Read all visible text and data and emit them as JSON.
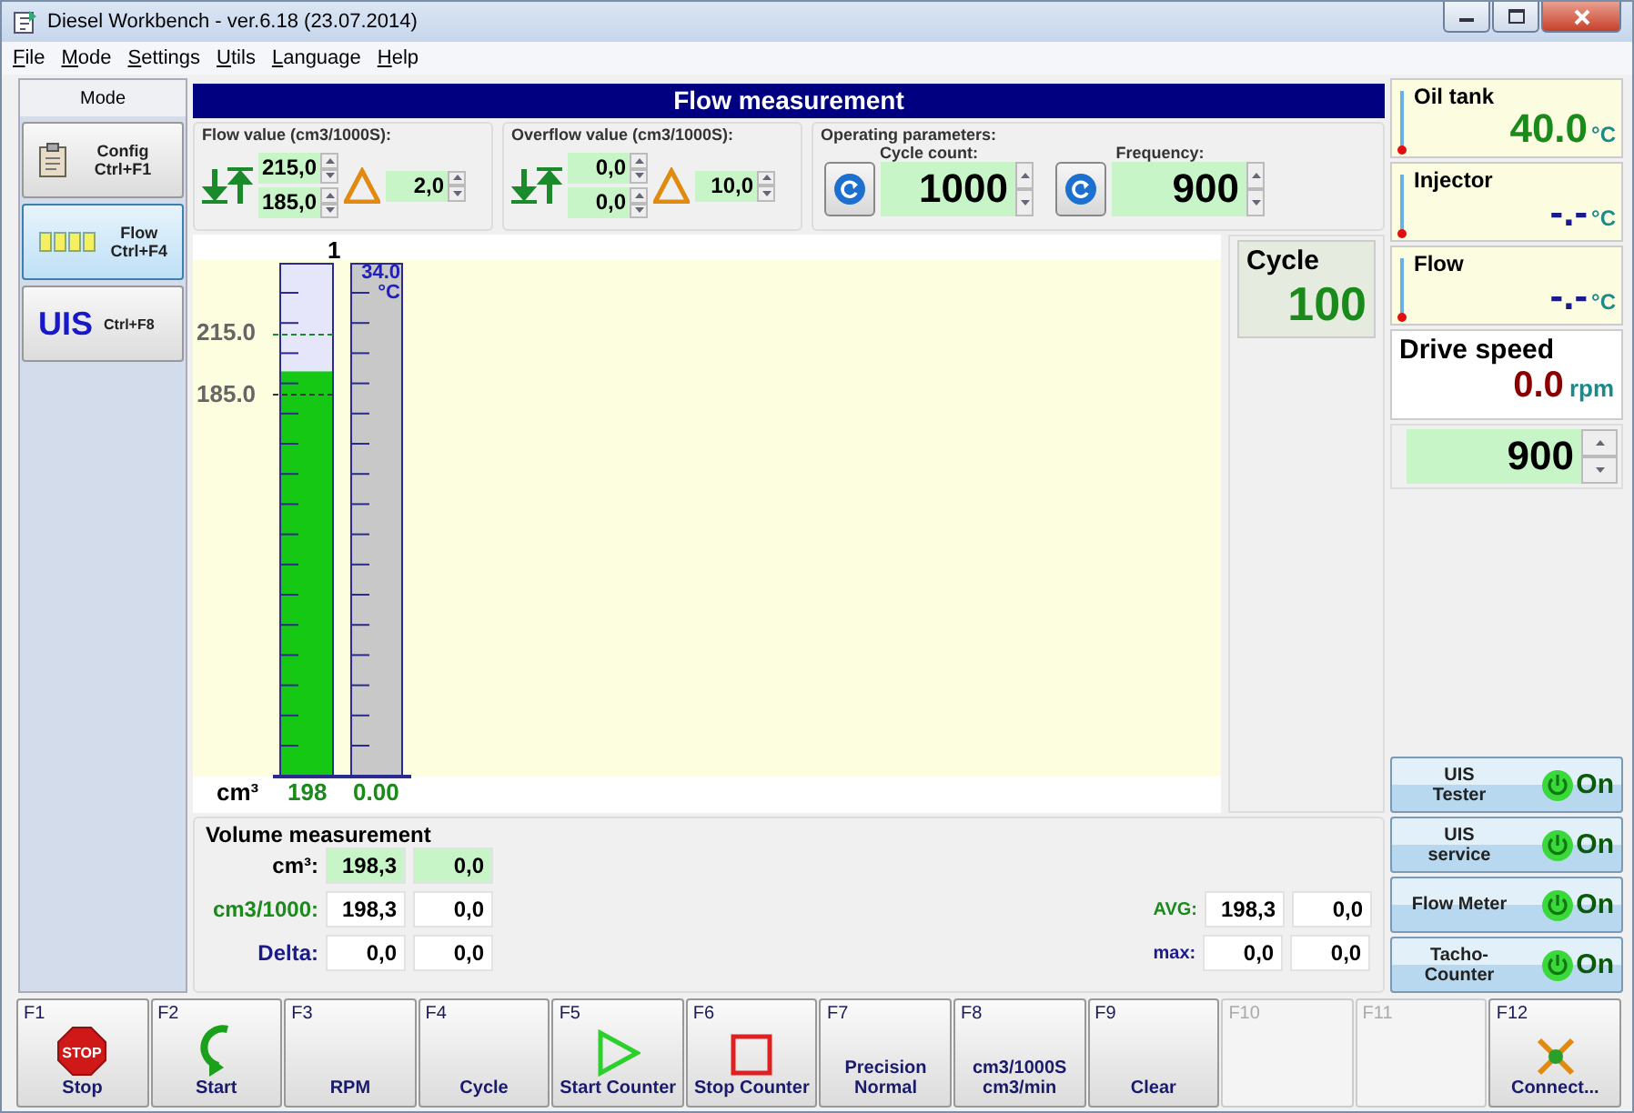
{
  "window": {
    "title": "Diesel Workbench - ver.6.18 (23.07.2014)"
  },
  "menu": [
    {
      "label": "File"
    },
    {
      "label": "Mode"
    },
    {
      "label": "Settings"
    },
    {
      "label": "Utils"
    },
    {
      "label": "Language"
    },
    {
      "label": "Help"
    }
  ],
  "mode_panel": {
    "title": "Mode",
    "items": [
      {
        "label": "Config",
        "shortcut": "Ctrl+F1",
        "kind": "clipboard",
        "selected": false
      },
      {
        "label": "Flow",
        "shortcut": "Ctrl+F4",
        "kind": "bars",
        "selected": true
      },
      {
        "label": "UIS",
        "shortcut": "Ctrl+F8",
        "kind": "big",
        "selected": false
      }
    ]
  },
  "header": {
    "title": "Flow measurement"
  },
  "flow_value": {
    "label": "Flow value (cm3/1000S):",
    "upper": "215,0",
    "lower": "185,0",
    "delta": "2,0"
  },
  "overflow_value": {
    "label": "Overflow value (cm3/1000S):",
    "upper": "0,0",
    "lower": "0,0",
    "delta": "10,0"
  },
  "operating_parameters": {
    "label": "Operating parameters:",
    "fields": [
      {
        "label": "Cycle count:",
        "value": "1000"
      },
      {
        "label": "Frequency:",
        "value": "900"
      }
    ]
  },
  "gauge": {
    "column": "1",
    "upper_mark": "215.0",
    "lower_mark": "185.0",
    "level": 0.79,
    "temperature": "34.0",
    "temperature_unit": "°C",
    "unit": "cm³",
    "volume": "198",
    "temperature_reading": "0.00"
  },
  "cycle": {
    "label": "Cycle",
    "value": "100"
  },
  "volume_measurement": {
    "title": "Volume measurement",
    "rows": [
      {
        "label": "cm³:",
        "color": "#000000",
        "highlighted": true,
        "values": [
          "198,3",
          "0,0"
        ]
      },
      {
        "label": "cm3/1000:",
        "color": "#1a8a1a",
        "highlighted": false,
        "values": [
          "198,3",
          "0,0"
        ]
      },
      {
        "label": "Delta:",
        "color": "#1a1a8a",
        "highlighted": false,
        "values": [
          "0,0",
          "0,0"
        ]
      }
    ],
    "stats": [
      {
        "label": "AVG:",
        "color": "#1a8a1a",
        "values": [
          "198,3",
          "0,0"
        ]
      },
      {
        "label": "max:",
        "color": "#1a1a8a",
        "values": [
          "0,0",
          "0,0"
        ]
      }
    ]
  },
  "sensors": [
    {
      "name": "Oil tank",
      "value": "40.0",
      "unit": "°C",
      "color": "#1a8a1a"
    },
    {
      "name": "Injector",
      "value": "-.-",
      "unit": "°C",
      "color": "#1a1a8a"
    },
    {
      "name": "Flow",
      "value": "-.-",
      "unit": "°C",
      "color": "#1a1a8a"
    }
  ],
  "drive_speed": {
    "label": "Drive speed",
    "value": "0.0",
    "unit": "rpm",
    "setpoint": "900"
  },
  "toggles": [
    {
      "lines": [
        "UIS",
        "Tester"
      ],
      "state": "On",
      "on": true
    },
    {
      "lines": [
        "UIS",
        "service"
      ],
      "state": "On",
      "on": true
    },
    {
      "lines": [
        "Flow Meter"
      ],
      "state": "On",
      "on": true
    },
    {
      "lines": [
        "Tacho-",
        "Counter"
      ],
      "state": "On",
      "on": true
    }
  ],
  "function_keys": [
    {
      "key": "F1",
      "kind": "stop",
      "sign": "STOP",
      "lines": [
        "Stop"
      ],
      "disabled": false
    },
    {
      "key": "F2",
      "kind": "start",
      "lines": [
        "Start"
      ],
      "disabled": false
    },
    {
      "key": "F3",
      "kind": "text",
      "lines": [
        "RPM"
      ],
      "disabled": false
    },
    {
      "key": "F4",
      "kind": "text",
      "lines": [
        "Cycle"
      ],
      "disabled": false
    },
    {
      "key": "F5",
      "kind": "play",
      "lines": [
        "Start Counter"
      ],
      "disabled": false
    },
    {
      "key": "F6",
      "kind": "square",
      "lines": [
        "Stop Counter"
      ],
      "disabled": false
    },
    {
      "key": "F7",
      "kind": "text",
      "lines": [
        "Precision",
        "Normal"
      ],
      "disabled": false
    },
    {
      "key": "F8",
      "kind": "text",
      "lines": [
        "cm3/1000S",
        "cm3/min"
      ],
      "disabled": false
    },
    {
      "key": "F9",
      "kind": "text",
      "lines": [
        "Clear"
      ],
      "disabled": false
    },
    {
      "key": "F10",
      "kind": "text",
      "disabled": true
    },
    {
      "key": "F11",
      "kind": "text",
      "disabled": true
    },
    {
      "key": "F12",
      "kind": "plug",
      "lines": [
        "Connect..."
      ],
      "disabled": false
    }
  ]
}
